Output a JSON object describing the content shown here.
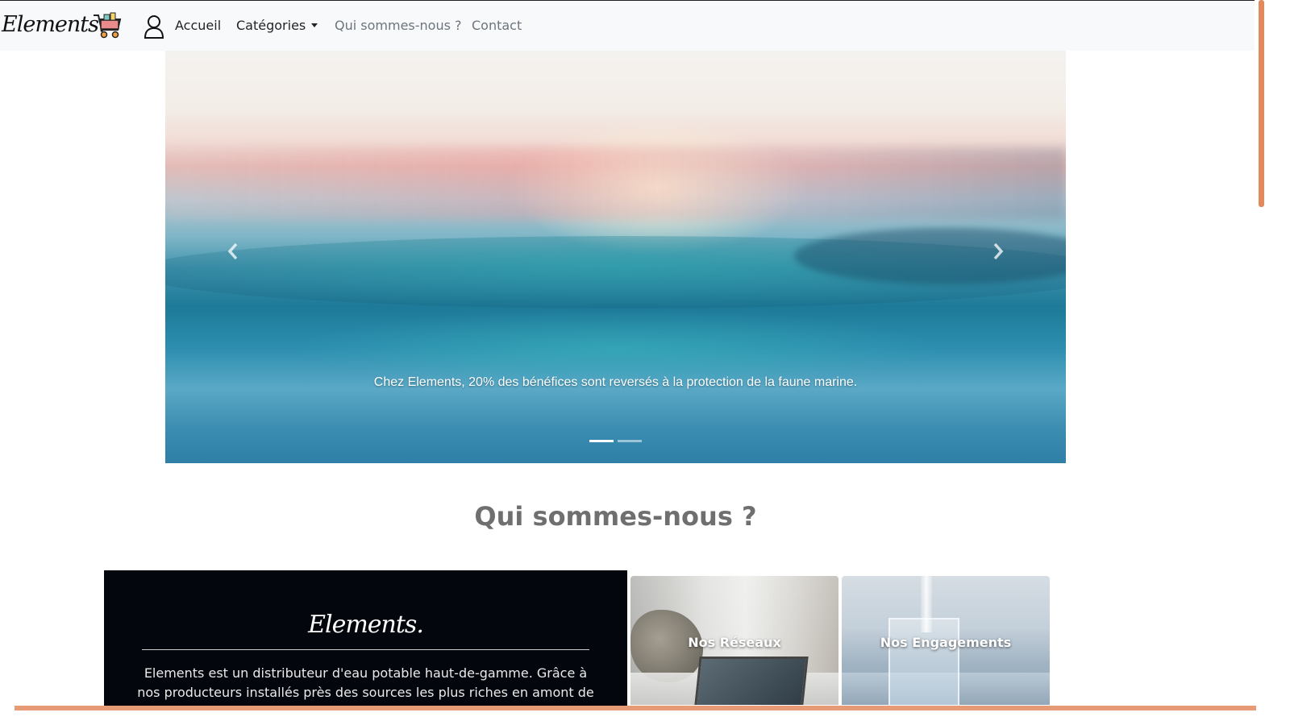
{
  "navbar": {
    "brand": "Elements.",
    "cart_icon": "shopping-cart-icon",
    "user_icon": "user-icon",
    "links": {
      "accueil": "Accueil",
      "categories": "Catégories",
      "qui": "Qui sommes-nous ?",
      "contact": "Contact"
    }
  },
  "carousel": {
    "caption": "Chez Elements, 20% des bénéfices sont reversés à la protection de la faune marine.",
    "prev_icon": "chevron-left-icon",
    "next_icon": "chevron-right-icon",
    "slide_count": 2,
    "active_slide": 1
  },
  "about": {
    "title": "Qui sommes-nous ?",
    "card_logo": "Elements.",
    "card_text_line1": "Elements est un distributeur d'eau potable haut-de-gamme. Grâce à",
    "card_text_line2": "nos producteurs installés près des sources les plus riches en amont de",
    "cards": [
      {
        "label": "Nos Réseaux"
      },
      {
        "label": "Nos Engagements"
      }
    ]
  },
  "colors": {
    "accent": "#e69a76",
    "navbar_bg": "#f8f9fa",
    "dark_card": "#03070d"
  }
}
